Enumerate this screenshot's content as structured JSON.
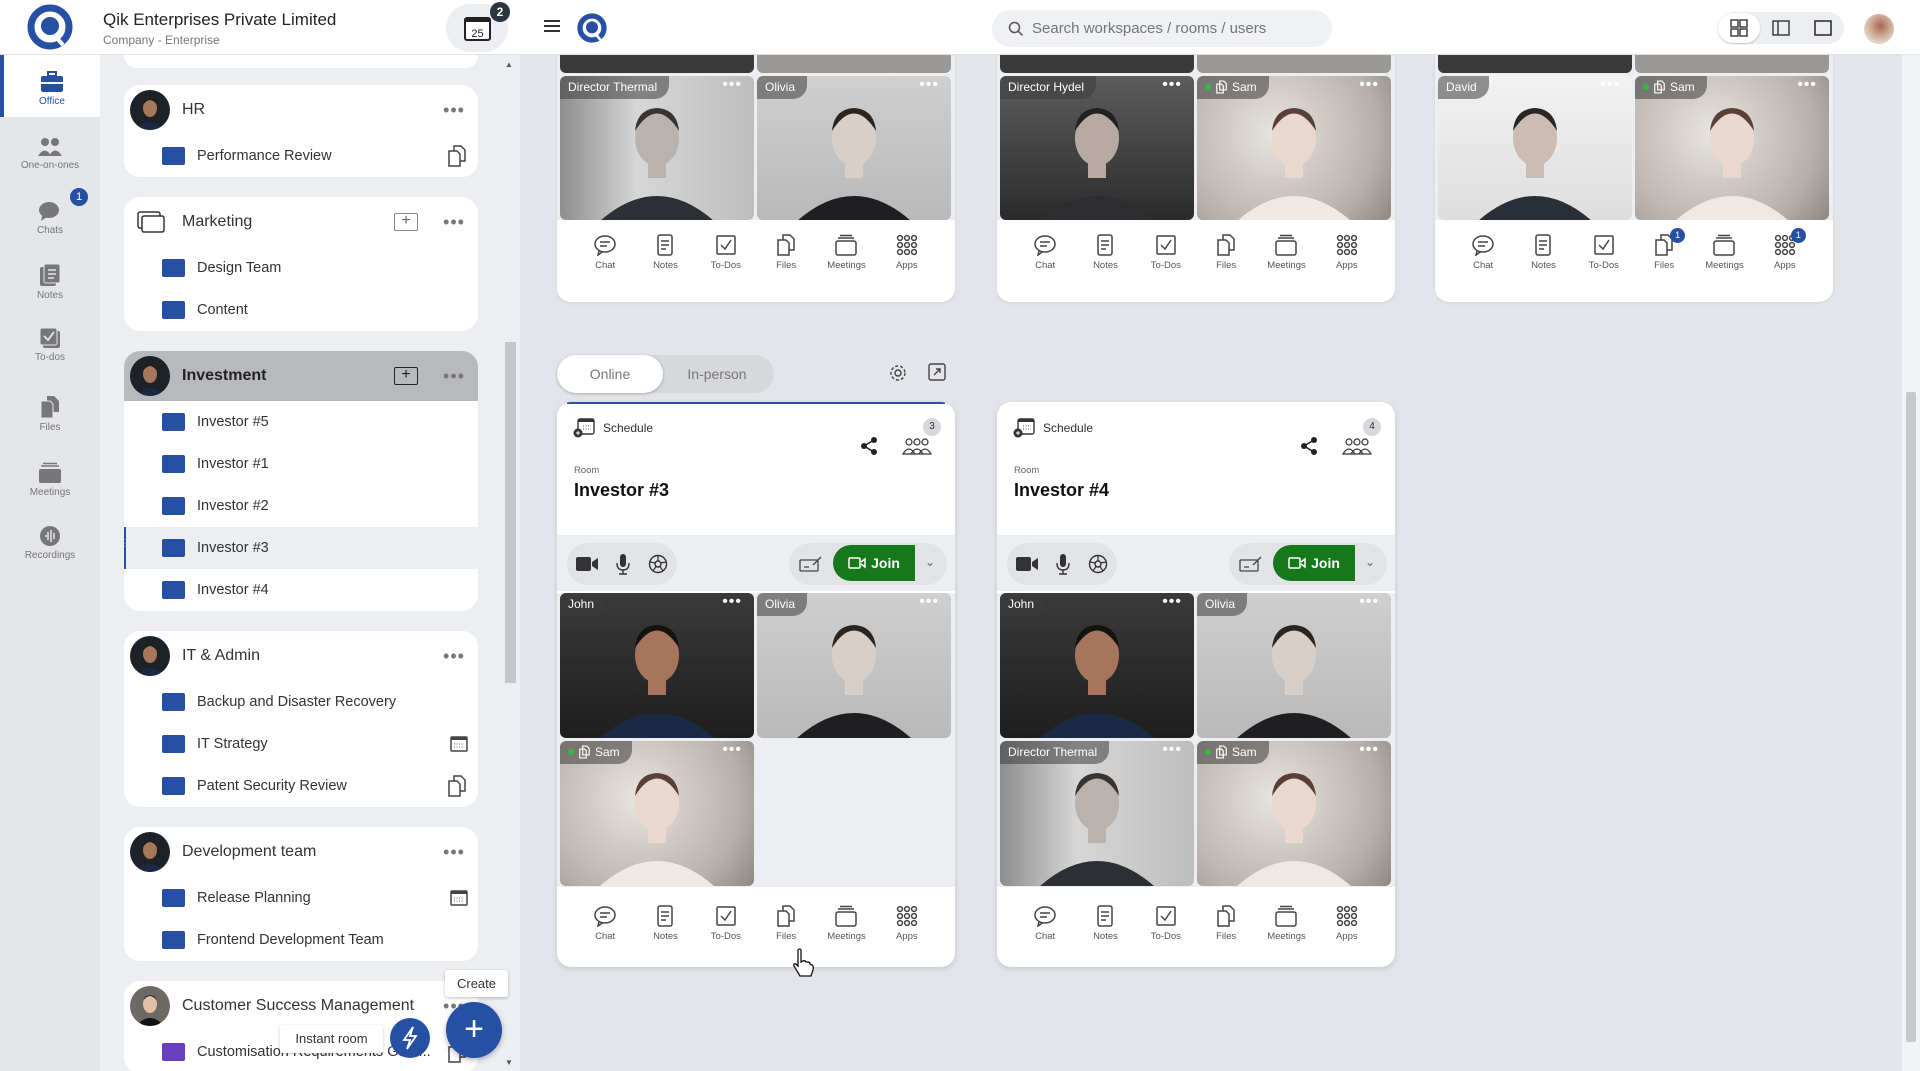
{
  "org": {
    "name": "Qik Enterprises Private Limited",
    "subtitle": "Company - Enterprise",
    "calendar_day": "25",
    "calendar_badge": "2"
  },
  "rail": [
    {
      "label": "Office",
      "icon": "briefcase-icon",
      "active": true
    },
    {
      "label": "One-on-ones",
      "icon": "people-icon"
    },
    {
      "label": "Chats",
      "icon": "chat-icon",
      "badge": "1"
    },
    {
      "label": "Notes",
      "icon": "notes-icon"
    },
    {
      "label": "To-dos",
      "icon": "todo-icon"
    },
    {
      "label": "Files",
      "icon": "files-icon"
    },
    {
      "label": "Meetings",
      "icon": "meetings-icon"
    },
    {
      "label": "Recordings",
      "icon": "recordings-icon"
    }
  ],
  "groups": [
    {
      "name": "HR",
      "avatar": "man",
      "items": [
        {
          "label": "Performance Review",
          "icon": "files"
        }
      ]
    },
    {
      "name": "Marketing",
      "avatar": "folder",
      "add": true,
      "items": [
        {
          "label": "Design Team"
        },
        {
          "label": "Content"
        }
      ]
    },
    {
      "name": "Investment",
      "avatar": "man",
      "add": true,
      "active": true,
      "items": [
        {
          "label": "Investor #5"
        },
        {
          "label": "Investor #1"
        },
        {
          "label": "Investor #2"
        },
        {
          "label": "Investor #3",
          "selected": true
        },
        {
          "label": "Investor #4"
        }
      ]
    },
    {
      "name": "IT & Admin",
      "avatar": "man",
      "items": [
        {
          "label": "Backup and Disaster Recovery"
        },
        {
          "label": "IT Strategy",
          "icon": "calendar"
        },
        {
          "label": "Patent Security Review",
          "icon": "files"
        }
      ]
    },
    {
      "name": "Development team",
      "avatar": "man",
      "items": [
        {
          "label": "Release Planning",
          "icon": "calendar"
        },
        {
          "label": "Frontend Development Team"
        }
      ]
    },
    {
      "name": "Customer Success Management",
      "avatar": "woman",
      "items": [
        {
          "label": "Customisation Requirements Gath...",
          "icon": "files",
          "color": "#6a3fbf"
        }
      ]
    }
  ],
  "fab": {
    "create_tip": "Create",
    "instant_room_tip": "Instant room"
  },
  "search": {
    "placeholder": "Search workspaces / rooms / users"
  },
  "view_modes": [
    "grid-view-icon",
    "sidebar-view-icon",
    "single-view-icon"
  ],
  "toolbar_labels": [
    "Chat",
    "Notes",
    "To-Dos",
    "Files",
    "Meetings",
    "Apps"
  ],
  "top_cards": [
    {
      "tiles": [
        {
          "name": "Director Thermal",
          "photo": "suit-man"
        },
        {
          "name": "Olivia",
          "photo": "woman"
        }
      ],
      "badges": {}
    },
    {
      "tiles": [
        {
          "name": "Director Hydel",
          "photo": "laptop-man"
        },
        {
          "name": "Sam",
          "photo": "girl",
          "online": true,
          "sharing": true
        }
      ],
      "badges": {}
    },
    {
      "tiles": [
        {
          "name": "David",
          "photo": "david"
        },
        {
          "name": "Sam",
          "photo": "girl",
          "online": true,
          "sharing": true
        }
      ],
      "badges": {
        "Files": "1",
        "Apps": "1"
      }
    }
  ],
  "mode_toggle": {
    "options": [
      "Online",
      "In-person"
    ],
    "selected": "Online"
  },
  "rooms": [
    {
      "schedule_label": "Schedule",
      "participants": "3",
      "room_label": "Room",
      "title": "Investor #3",
      "join_label": "Join",
      "active": true,
      "tiles": [
        {
          "name": "John",
          "photo": "john"
        },
        {
          "name": "Olivia",
          "photo": "woman"
        },
        {
          "name": "Sam",
          "photo": "girl",
          "online": true,
          "sharing": true
        }
      ]
    },
    {
      "schedule_label": "Schedule",
      "participants": "4",
      "room_label": "Room",
      "title": "Investor #4",
      "join_label": "Join",
      "tiles": [
        {
          "name": "John",
          "photo": "john"
        },
        {
          "name": "Olivia",
          "photo": "woman"
        },
        {
          "name": "Director Thermal",
          "photo": "suit-man"
        },
        {
          "name": "Sam",
          "photo": "girl",
          "online": true,
          "sharing": true
        }
      ]
    }
  ],
  "colors": {
    "accent": "#2650a4",
    "join": "#15781a",
    "online": "#2dbb3a"
  }
}
